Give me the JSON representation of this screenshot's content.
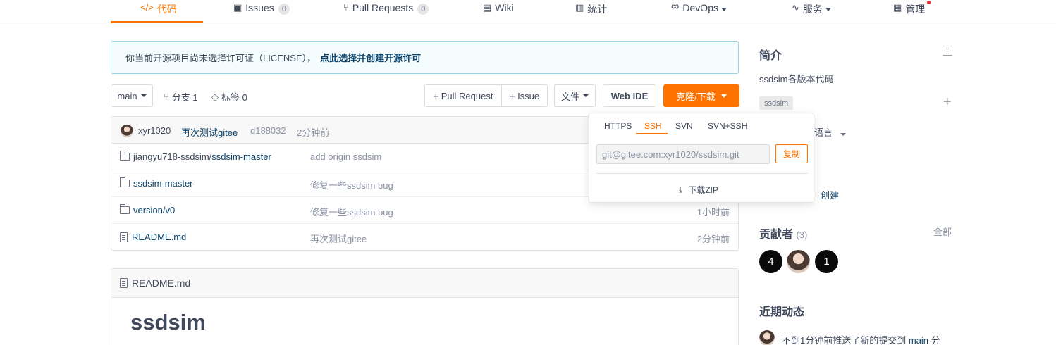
{
  "nav": {
    "code": "代码",
    "issues": "Issues",
    "issues_count": "0",
    "pulls": "Pull Requests",
    "pulls_count": "0",
    "wiki": "Wiki",
    "stats": "统计",
    "devops": "DevOps",
    "services": "服务",
    "manage": "管理"
  },
  "banner": {
    "text": "你当前开源项目尚未选择许可证（LICENSE），",
    "link": "点此选择并创建开源许可"
  },
  "toolbar": {
    "branch": "main",
    "branches": "分支 1",
    "tags": "标签 0",
    "pull_request": "+ Pull Request",
    "issue": "+ Issue",
    "file": "文件",
    "web_ide": "Web IDE",
    "clone": "克隆/下载"
  },
  "commit": {
    "author": "xyr1020",
    "message": "再次测试gitee",
    "hash": "d188032",
    "time": "2分钟前"
  },
  "files": [
    {
      "prefix": "jiangyu718-ssdsim/",
      "name": "ssdsim-master",
      "type": "folder",
      "message": "add origin ssdsim",
      "time": ""
    },
    {
      "prefix": "",
      "name": "ssdsim-master",
      "type": "folder",
      "message": "修复一些ssdsim bug",
      "time": ""
    },
    {
      "prefix": "",
      "name": "version/v0",
      "type": "folder",
      "message": "修复一些ssdsim bug",
      "time": "1小时前"
    },
    {
      "prefix": "",
      "name": "README.md",
      "type": "file",
      "message": "再次测试gitee",
      "time": "2分钟前"
    }
  ],
  "readme": {
    "filename": "README.md",
    "heading": "ssdsim"
  },
  "clone_dropdown": {
    "tabs": [
      "HTTPS",
      "SSH",
      "SVN",
      "SVN+SSH"
    ],
    "active_tab": "SSH",
    "url": "git@gitee.com:xyr1020/ssdsim.git",
    "copy": "复制",
    "download_zip": "下载ZIP"
  },
  "sidebar": {
    "intro_title": "简介",
    "description": "ssdsim各版本代码",
    "tag": "ssdsim",
    "language_partial": "语言",
    "create_partial": "创建",
    "contributors_title": "贡献者",
    "contributors_count": "(3)",
    "all": "全部",
    "contributor_badges": [
      "4",
      "1"
    ],
    "activity_title": "近期动态",
    "activity_text": "不到1分钟前推送了新的提交到",
    "activity_branch": "main",
    "activity_suffix": "分"
  },
  "colors": {
    "accent": "#fe7300",
    "link": "#0b4269",
    "muted": "#8c92a4"
  }
}
